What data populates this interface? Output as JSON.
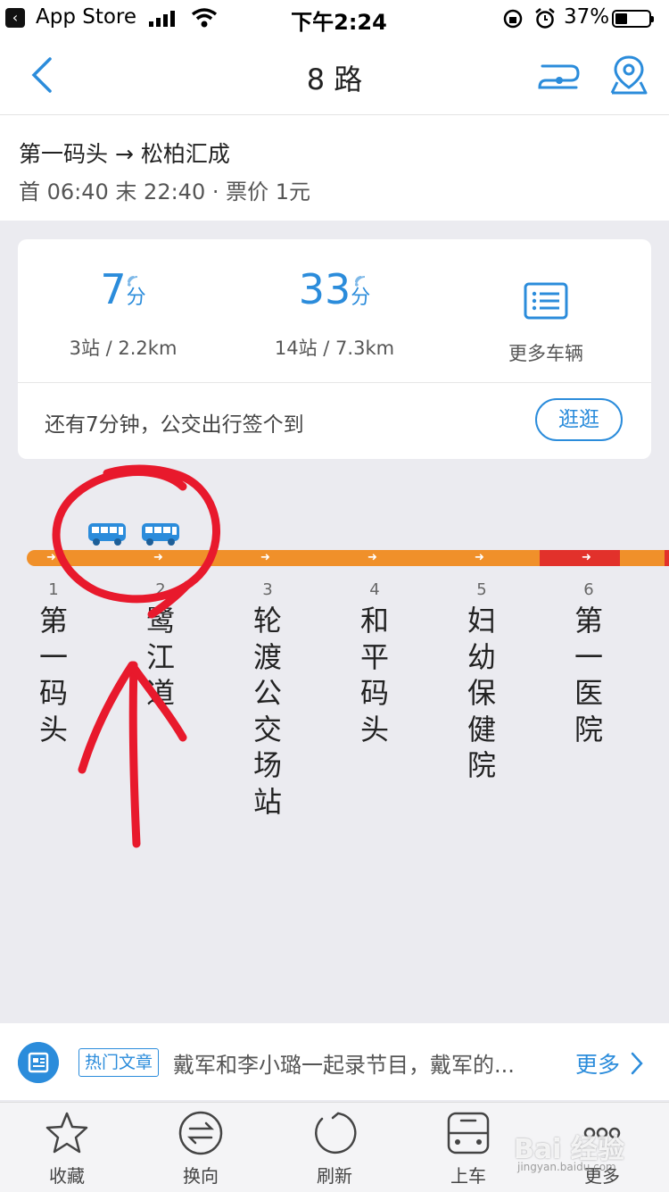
{
  "status_bar": {
    "back_app": "App Store",
    "time": "下午2:24",
    "battery": "37%",
    "battery_level": 0.37
  },
  "nav": {
    "title": "8 路"
  },
  "route": {
    "direction": "第一码头 → 松柏汇成",
    "schedule": "首 06:40 末 22:40 · 票价 1元"
  },
  "arrivals": [
    {
      "minutes": "7",
      "unit": "分",
      "detail": "3站 / 2.2km"
    },
    {
      "minutes": "33",
      "unit": "分",
      "detail": "14站 / 7.3km"
    }
  ],
  "more_vehicles": "更多车辆",
  "promo": {
    "text": "还有7分钟，公交出行签个到",
    "button": "逛逛"
  },
  "stops": [
    {
      "num": "1",
      "name": "第\n一\n码\n头"
    },
    {
      "num": "2",
      "name": "鹭\n江\n道"
    },
    {
      "num": "3",
      "name": "轮\n渡\n公\n交\n场\n站"
    },
    {
      "num": "4",
      "name": "和\n平\n码\n头"
    },
    {
      "num": "5",
      "name": "妇\n幼\n保\n健\n院"
    },
    {
      "num": "6",
      "name": "第\n一\n医\n院"
    }
  ],
  "news": {
    "tag": "热门文章",
    "headline": "戴军和李小璐一起录节目，戴军的...",
    "more": "更多"
  },
  "toolbar": {
    "favorite": "收藏",
    "reverse": "换向",
    "refresh": "刷新",
    "board": "上车",
    "more": "更多"
  },
  "watermark": "Bai 经验",
  "watermark_sub": "jingyan.baidu.com",
  "colors": {
    "accent": "#2b8cdb",
    "track": "#f0902a",
    "congested": "#e2312b",
    "annotation": "#e8192c"
  }
}
